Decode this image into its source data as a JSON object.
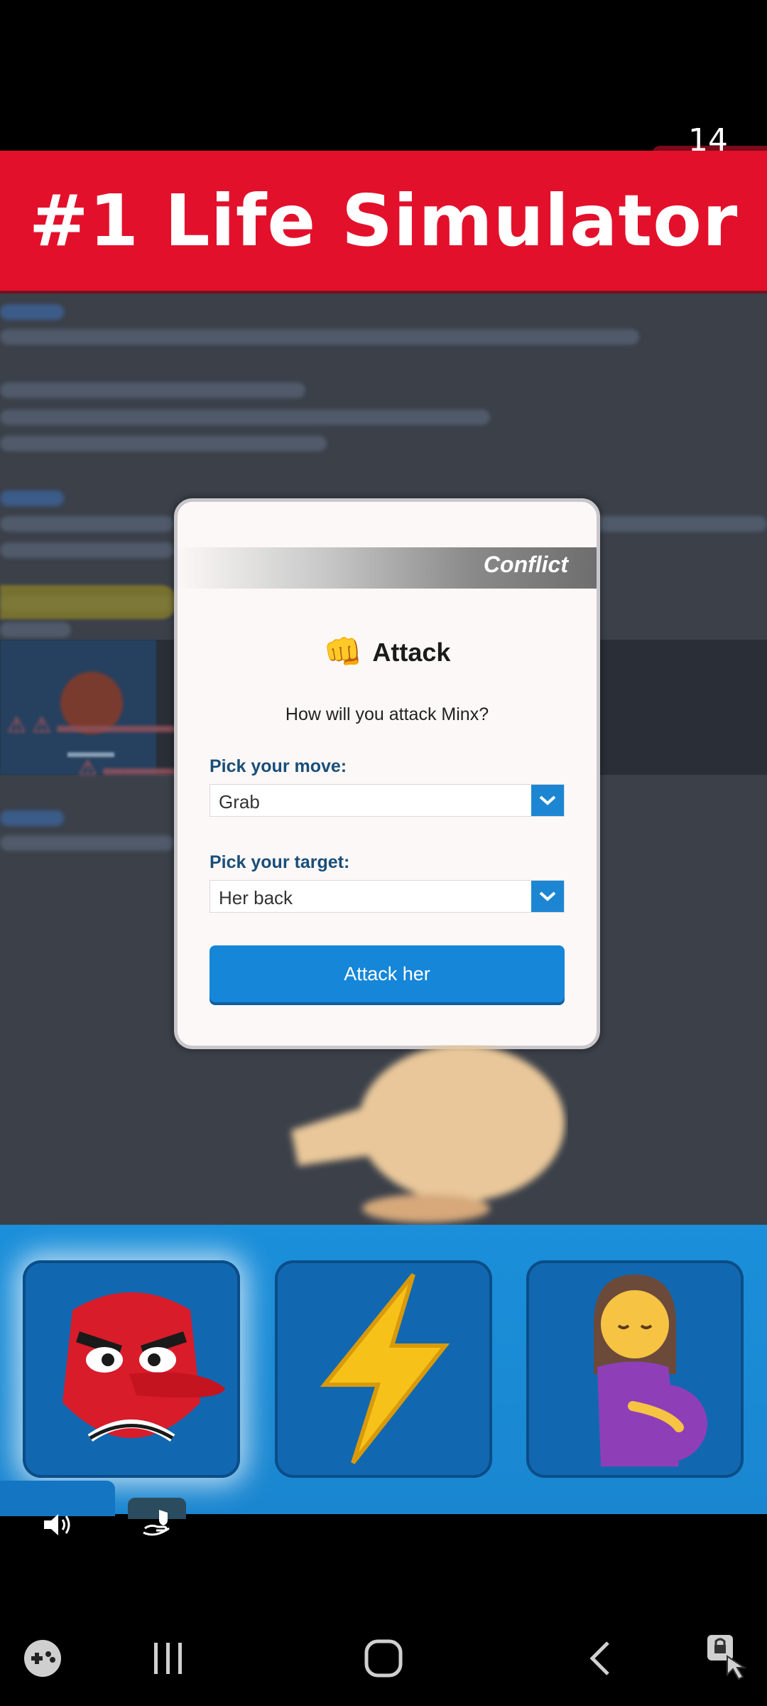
{
  "status": {
    "counter": "14"
  },
  "banner": {
    "title": "#1 Life Simulator"
  },
  "dialog": {
    "header_label": "Conflict",
    "title": "Attack",
    "question": "How will you attack Minx?",
    "move_label": "Pick your move:",
    "move_value": "Grab",
    "target_label": "Pick your target:",
    "target_value": "Her back",
    "action_button": "Attack her"
  },
  "tray": {
    "tiles": [
      {
        "icon": "angry-goblin-mask-icon"
      },
      {
        "icon": "lightning-bolt-icon"
      },
      {
        "icon": "pregnant-woman-icon"
      }
    ]
  },
  "colors": {
    "banner": "#e3102c",
    "tray": "#1b8fda",
    "button": "#1586d8",
    "label_blue": "#194e79"
  }
}
